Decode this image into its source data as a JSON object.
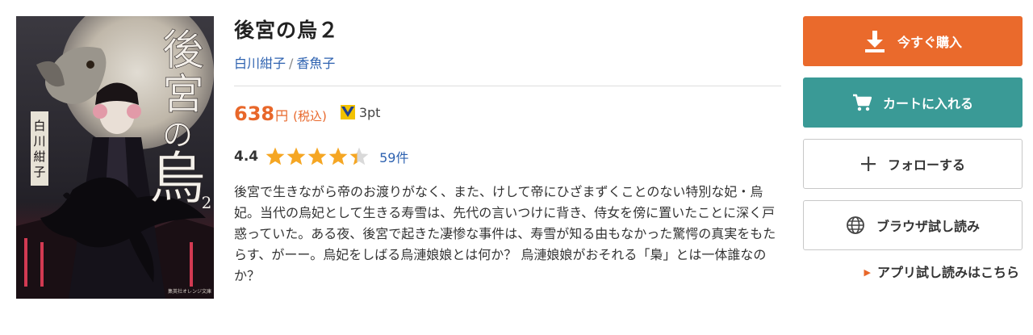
{
  "book": {
    "title": "後宮の烏２",
    "authors": [
      {
        "name": "白川紺子"
      },
      {
        "name": "香魚子"
      }
    ],
    "author_separator": "/",
    "price": {
      "amount": "638",
      "unit": "円",
      "tax_label": "(税込)"
    },
    "points": "3pt",
    "rating": {
      "score": "4.4",
      "stars_value": 4.4,
      "stars_max": 5,
      "count_label": "59件"
    },
    "description": "後宮で生きながら帝のお渡りがなく、また、けして帝にひざまずくことのない特別な妃・烏妃。当代の烏妃として生きる寿雪は、先代の言いつけに背き、侍女を傍に置いたことに深く戸惑っていた。ある夜、後宮で起きた凄惨な事件は、寿雪が知る由もなかった驚愕の真実をもたらす、がーー。烏妃をしばる烏漣娘娘とは何か？ 烏漣娘娘がおそれる「梟」とは一体誰なのか？"
  },
  "cover": {
    "title_chars": [
      "後",
      "宮",
      "の",
      "烏"
    ],
    "volume": "2",
    "author_vertical": "白川紺子",
    "publisher_text": "集英社オレンジ文庫"
  },
  "actions": {
    "buy_label": "今すぐ購入",
    "cart_label": "カートに入れる",
    "follow_label": "フォローする",
    "browser_trial_label": "ブラウザ試し読み",
    "app_trial_label": "アプリ試し読みはこちら"
  },
  "icons": {
    "buy": "download-icon",
    "cart": "cart-icon",
    "follow": "plus-icon",
    "browser": "globe-icon",
    "points": "v-point-icon",
    "app": "triangle-right-icon"
  },
  "colors": {
    "buy": "#ea6a2c",
    "cart": "#3a9a96",
    "price": "#e8672a",
    "link": "#2e62b0",
    "star": "#f5a623"
  }
}
